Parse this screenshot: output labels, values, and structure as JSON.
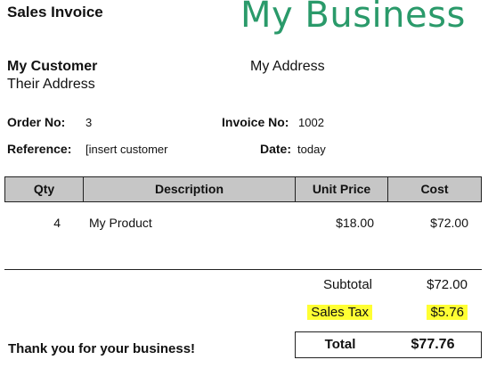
{
  "header": {
    "title": "Sales Invoice",
    "brand": "My Business"
  },
  "customer": {
    "name": "My Customer",
    "address": "Their Address"
  },
  "business": {
    "address": "My Address"
  },
  "details": {
    "order_label": "Order No:",
    "order_value": "3",
    "invoice_label": "Invoice No:",
    "invoice_value": "1002",
    "reference_label": "Reference:",
    "reference_value": "[insert customer",
    "date_label": "Date:",
    "date_value": "today"
  },
  "table": {
    "columns": [
      "Qty",
      "Description",
      "Unit Price",
      "Cost"
    ],
    "rows": [
      {
        "qty": "4",
        "description": "My Product",
        "unit_price": "$18.00",
        "cost": "$72.00"
      }
    ]
  },
  "summary": {
    "subtotal_label": "Subtotal",
    "subtotal_value": "$72.00",
    "tax_label": "Sales Tax",
    "tax_value": "$5.76",
    "total_label": "Total",
    "total_value": "$77.76",
    "highlight_color": "#ffff33"
  },
  "footer": {
    "thanks": "Thank you for your business!"
  },
  "colors": {
    "brand": "#2a9a6a",
    "header_bg": "#c6c6c6"
  }
}
